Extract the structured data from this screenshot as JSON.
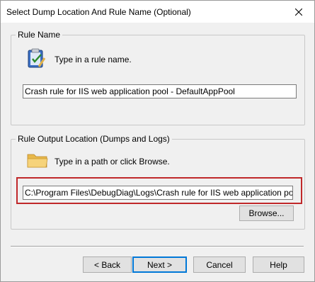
{
  "window": {
    "title": "Select Dump Location And Rule Name (Optional)"
  },
  "rule_name": {
    "legend": "Rule Name",
    "instruction": "Type in a rule name.",
    "value": "Crash rule for IIS web application pool - DefaultAppPool"
  },
  "output_location": {
    "legend": "Rule Output Location (Dumps and Logs)",
    "instruction": "Type in a path or click Browse.",
    "value": "C:\\Program Files\\DebugDiag\\Logs\\Crash rule for IIS web application pool - DefaultAppPool",
    "browse_label": "Browse..."
  },
  "buttons": {
    "back": "< Back",
    "next": "Next >",
    "cancel": "Cancel",
    "help": "Help"
  },
  "colors": {
    "highlight": "#c0282a",
    "default_button_border": "#0078d7"
  }
}
